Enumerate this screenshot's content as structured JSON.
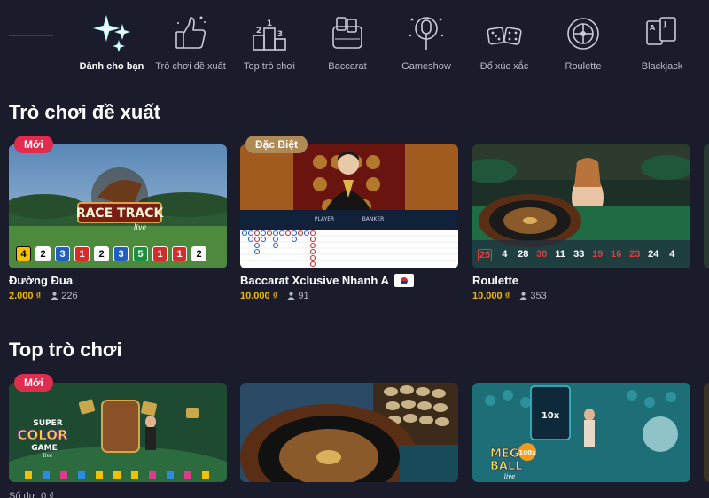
{
  "nav": {
    "categories": [
      {
        "label": "Dành cho bạn",
        "icon": "sparkles-icon",
        "active": true
      },
      {
        "label": "Trò chơi đề xuất",
        "icon": "thumbs-up-icon",
        "active": false
      },
      {
        "label": "Top trò chơi",
        "icon": "podium-icon",
        "active": false
      },
      {
        "label": "Baccarat",
        "icon": "baccarat-cards-icon",
        "active": false
      },
      {
        "label": "Gameshow",
        "icon": "microphone-icon",
        "active": false
      },
      {
        "label": "Đổ xúc xắc",
        "icon": "dice-icon",
        "active": false
      },
      {
        "label": "Roulette",
        "icon": "roulette-wheel-icon",
        "active": false
      },
      {
        "label": "Blackjack",
        "icon": "playing-cards-icon",
        "active": false
      }
    ]
  },
  "sections": {
    "recommended": {
      "title": "Trò chơi đề xuất",
      "games": [
        {
          "badge": "Mới",
          "name": "Đường Đua",
          "price": "2.000 ₫",
          "players": "226",
          "logo_line1": "RACE TRACK",
          "logo_line2": "live",
          "results": [
            "4",
            "2",
            "3",
            "1",
            "2",
            "3",
            "5",
            "1",
            "1",
            "2"
          ]
        },
        {
          "badge": "Đặc Biệt",
          "name": "Baccarat Xclusive Nhanh A",
          "price": "10.000 ₫",
          "players": "91",
          "table_text_left": "PLAYER",
          "table_text_right": "BANKER"
        },
        {
          "name": "Roulette",
          "price": "10.000 ₫",
          "players": "353",
          "results": [
            "25",
            "4",
            "28",
            "30",
            "11",
            "33",
            "19",
            "16",
            "23",
            "24",
            "4"
          ]
        }
      ]
    },
    "top": {
      "title": "Top trò chơi",
      "games": [
        {
          "badge": "Mới",
          "logo_line1": "SUPER",
          "logo_line2": "COLOR",
          "logo_line3": "GAME",
          "logo_line4": "live",
          "partial_text": "Số dư: 0 ₫"
        },
        {},
        {
          "logo_line1": "MEGA",
          "logo_line2": "BALL",
          "logo_badge": "100x",
          "logo_line3": "live",
          "screen_text": "10x"
        }
      ]
    }
  },
  "colors": {
    "background": "#1b1c2b",
    "price": "#f2b705",
    "badge_new": "#e02d4f",
    "badge_special": "#b08a56",
    "roulette_red": "#e23b3b",
    "result_yellow": "#f2c200",
    "result_blue": "#1f5fbf",
    "result_red": "#d42b2b",
    "result_green": "#1e8f3e"
  }
}
